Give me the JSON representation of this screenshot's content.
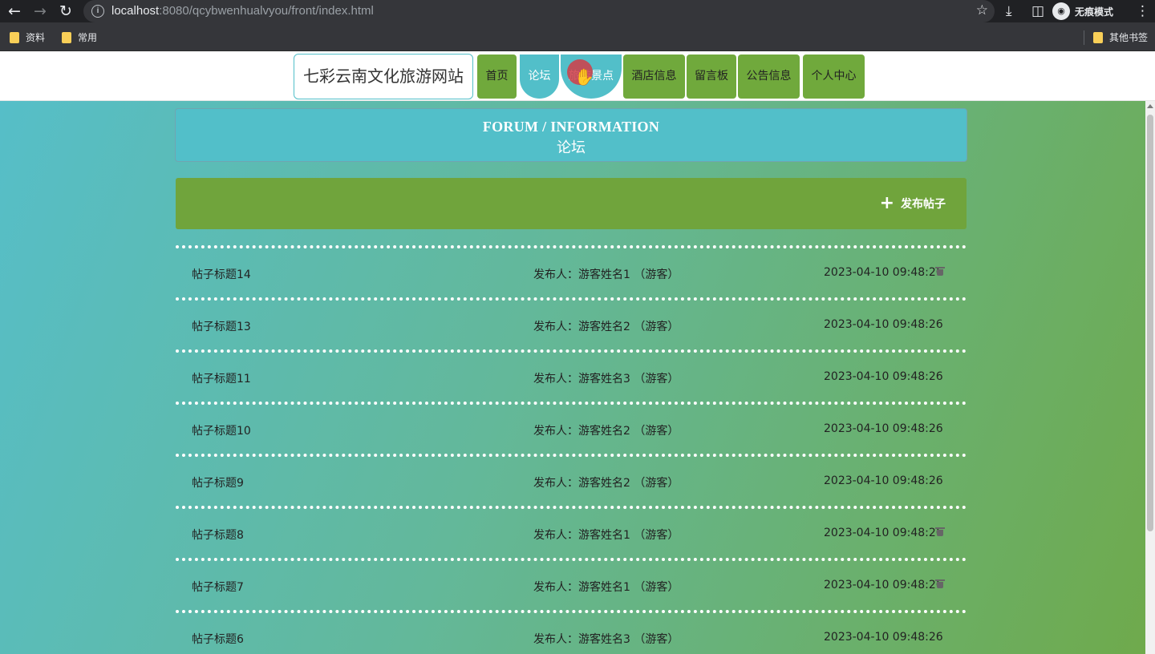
{
  "browser": {
    "url_host": "localhost",
    "url_rest": ":8080/qcybwenhualvyou/front/index.html",
    "incognito_label": "无痕模式",
    "bookmarks": [
      "资料",
      "常用"
    ],
    "other_bookmarks": "其他书签"
  },
  "header": {
    "site_title": "七彩云南文化旅游网站",
    "nav": [
      "首页",
      "论坛",
      "旅游景点",
      "酒店信息",
      "留言板",
      "公告信息",
      "个人中心"
    ]
  },
  "banner": {
    "title_en": "FORUM / INFORMATION",
    "title_cn": "论坛"
  },
  "actions": {
    "publish_label": "发布帖子"
  },
  "posts": [
    {
      "title": "帖子标题14",
      "author": "发布人：游客姓名1 （游客）",
      "time": "2023-04-10 09:48:26",
      "deletable": true
    },
    {
      "title": "帖子标题13",
      "author": "发布人：游客姓名2 （游客）",
      "time": "2023-04-10 09:48:26",
      "deletable": false
    },
    {
      "title": "帖子标题11",
      "author": "发布人：游客姓名3 （游客）",
      "time": "2023-04-10 09:48:26",
      "deletable": false
    },
    {
      "title": "帖子标题10",
      "author": "发布人：游客姓名2 （游客）",
      "time": "2023-04-10 09:48:26",
      "deletable": false
    },
    {
      "title": "帖子标题9",
      "author": "发布人：游客姓名2 （游客）",
      "time": "2023-04-10 09:48:26",
      "deletable": false
    },
    {
      "title": "帖子标题8",
      "author": "发布人：游客姓名1 （游客）",
      "time": "2023-04-10 09:48:26",
      "deletable": true
    },
    {
      "title": "帖子标题7",
      "author": "发布人：游客姓名1 （游客）",
      "time": "2023-04-10 09:48:26",
      "deletable": true
    },
    {
      "title": "帖子标题6",
      "author": "发布人：游客姓名3 （游客）",
      "time": "2023-04-10 09:48:26",
      "deletable": false
    }
  ],
  "colors": {
    "nav_green": "#70a93c",
    "nav_active_teal": "#52bfc9",
    "action_bar": "#70a43c"
  }
}
